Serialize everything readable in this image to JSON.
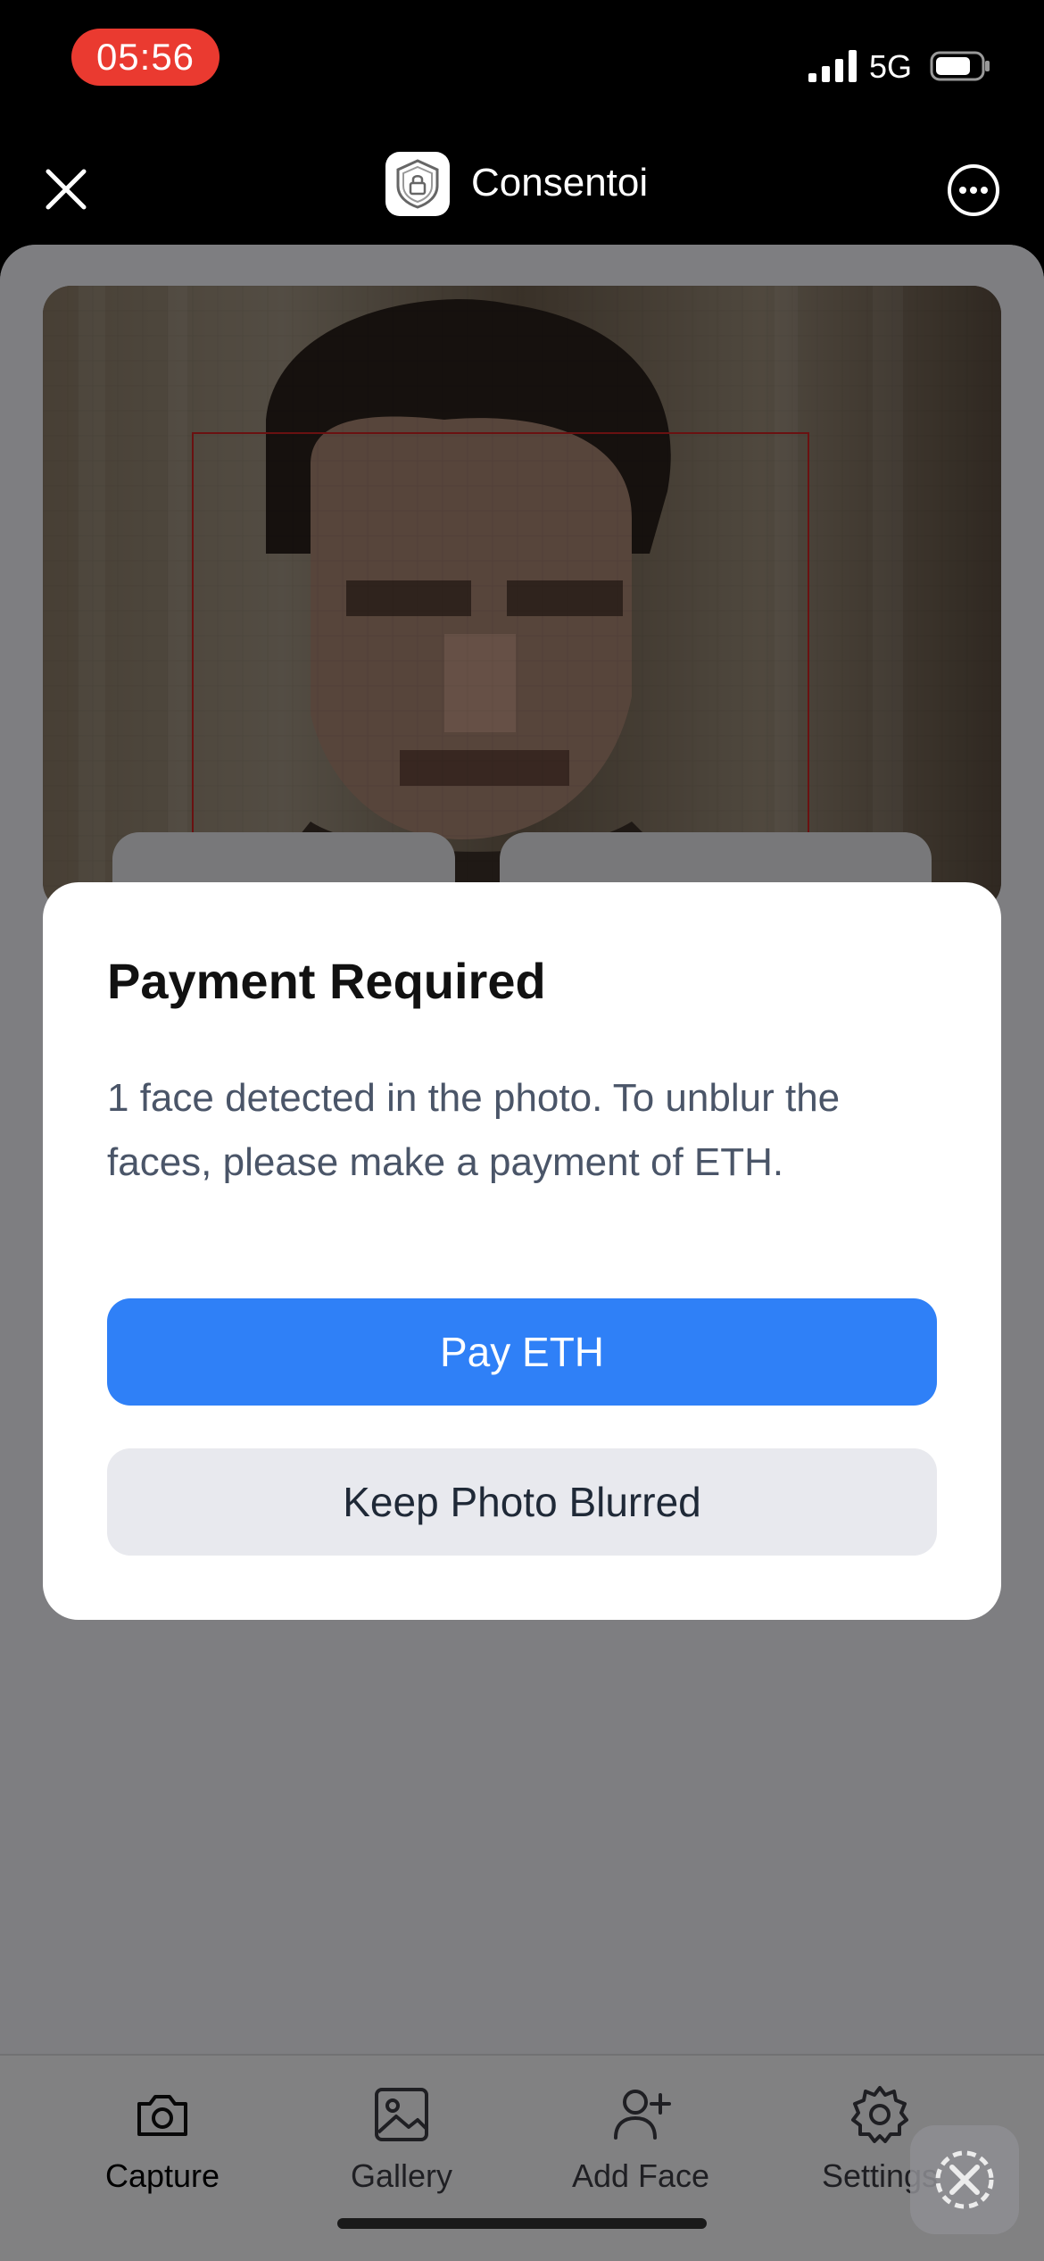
{
  "status_bar": {
    "time": "05:56",
    "network": "5G",
    "time_pill_color": "#ea3a30"
  },
  "header": {
    "app_title": "Consentoi"
  },
  "dialog": {
    "title": "Payment Required",
    "message": "1 face detected in the photo. To unblur the faces, please make a payment of ETH.",
    "pay_button": "Pay ETH",
    "keep_button": "Keep Photo Blurred"
  },
  "tabs": [
    {
      "label": "Capture",
      "icon": "camera-icon",
      "active": true
    },
    {
      "label": "Gallery",
      "icon": "image-icon",
      "active": false
    },
    {
      "label": "Add Face",
      "icon": "add-person-icon",
      "active": false
    },
    {
      "label": "Settings",
      "icon": "gear-icon",
      "active": false
    }
  ],
  "colors": {
    "accent": "#2f80f7",
    "secondary_button": "#e8e9ee",
    "face_box": "#cc2222"
  }
}
